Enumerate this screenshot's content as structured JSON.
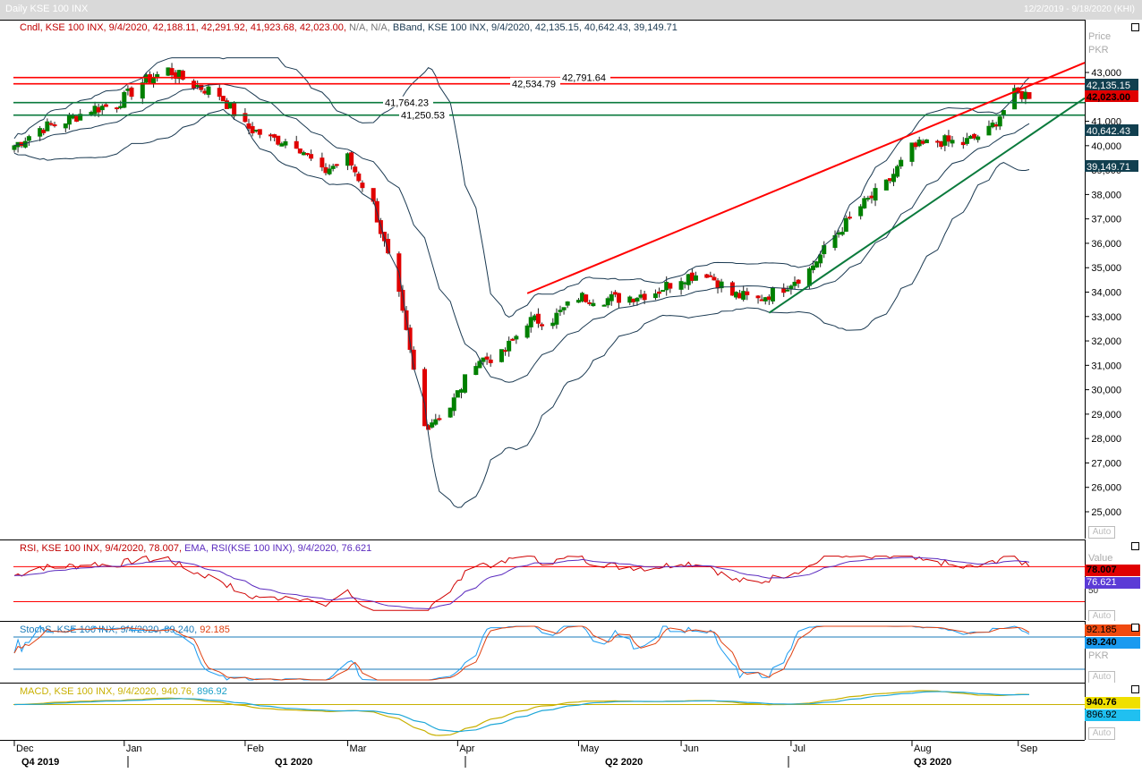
{
  "window": {
    "title": "Daily KSE 100 INX",
    "range": "12/2/2019 - 9/18/2020 (KHI)"
  },
  "price_pane": {
    "legend_cndl": "Cndl, KSE 100 INX, 9/4/2020, 42,188.11, 42,291.92, 41,923.68, 42,023.00,",
    "legend_na": "N/A, N/A,",
    "legend_bband": "BBand, KSE 100 INX, 9/4/2020, 42,135.15, 40,642.43, 39,149.71",
    "scale_title": "Price",
    "scale_unit": "PKR",
    "axis_button": "Auto",
    "ticks": [
      "43,000",
      "42,000",
      "41,000",
      "40,000",
      "39,000",
      "38,000",
      "37,000",
      "36,000",
      "35,000",
      "34,000",
      "33,000",
      "32,000",
      "31,000",
      "30,000",
      "29,000",
      "28,000",
      "27,000",
      "26,000",
      "25,000"
    ],
    "tick_values": [
      43000,
      42000,
      41000,
      40000,
      39000,
      38000,
      37000,
      36000,
      35000,
      34000,
      33000,
      32000,
      31000,
      30000,
      29000,
      28000,
      27000,
      26000,
      25000
    ],
    "value_tags": {
      "bb_upper": "42,135.15",
      "close": "42,023.00",
      "bb_mid": "40,642.43",
      "bb_lower": "39,149.71"
    },
    "levels": {
      "red_top": "42,791.64",
      "red_second": "42,534.79",
      "green_top": "41,764.23",
      "green_second": "41,250.53"
    },
    "colors": {
      "up": "#008000",
      "down": "#e00000",
      "band": "#1b3a52",
      "res": "#ff0000",
      "sup": "#0a7a3c"
    }
  },
  "rsi_pane": {
    "legend_rsi": "RSI, KSE 100 INX, 9/4/2020, 78.007,",
    "legend_ema": "EMA, RSI(KSE 100 INX), 9/4/2020, 76.621",
    "scale_title": "Value",
    "value_tags": {
      "rsi": "78.007",
      "ema": "76.621"
    },
    "tick": "50",
    "axis_button": "Auto"
  },
  "stoch_pane": {
    "legend_a": "StochS, KSE 100 INX, 9/4/2020, 89.240,",
    "legend_b": "92.185",
    "scale_unit": "PKR",
    "value_tags": {
      "d": "92.185",
      "k": "89.240"
    },
    "axis_button": "Auto"
  },
  "macd_pane": {
    "legend_a": "MACD, KSE 100 INX, 9/4/2020, 940.76,",
    "legend_b": "896.92",
    "value_tags": {
      "macd": "940.76",
      "signal": "896.92"
    },
    "axis_button": "Auto"
  },
  "x_axis": {
    "months": [
      "Dec",
      "Jan",
      "Feb",
      "Mar",
      "Apr",
      "May",
      "Jun",
      "Jul",
      "Aug",
      "Sep"
    ],
    "quarters": [
      "Q4 2019",
      "Q1 2020",
      "Q2 2020",
      "Q3 2020"
    ]
  },
  "chart_data": {
    "type": "candlestick",
    "title": "Daily KSE 100 INX",
    "ylabel": "Price PKR",
    "ylim": [
      24500,
      43500
    ],
    "x_range": [
      "12/2/2019",
      "9/18/2020"
    ],
    "month_positions": [
      "2019-12-02",
      "2020-01-01",
      "2020-02-03",
      "2020-03-02",
      "2020-04-01",
      "2020-05-04",
      "2020-06-01",
      "2020-07-01",
      "2020-08-03",
      "2020-09-01"
    ],
    "weekly_close_approx": {
      "dates": [
        "2019-12-02",
        "2019-12-09",
        "2019-12-16",
        "2019-12-23",
        "2019-12-30",
        "2020-01-06",
        "2020-01-13",
        "2020-01-20",
        "2020-01-27",
        "2020-02-03",
        "2020-02-10",
        "2020-02-17",
        "2020-02-24",
        "2020-03-02",
        "2020-03-09",
        "2020-03-16",
        "2020-03-23",
        "2020-03-30",
        "2020-04-06",
        "2020-04-13",
        "2020-04-20",
        "2020-04-27",
        "2020-05-04",
        "2020-05-11",
        "2020-05-18",
        "2020-05-25",
        "2020-06-01",
        "2020-06-08",
        "2020-06-15",
        "2020-06-22",
        "2020-06-29",
        "2020-07-06",
        "2020-07-13",
        "2020-07-20",
        "2020-07-27",
        "2020-08-03",
        "2020-08-10",
        "2020-08-17",
        "2020-08-24",
        "2020-08-31"
      ],
      "values": [
        40000,
        40700,
        41000,
        41500,
        41700,
        42600,
        43100,
        42500,
        42100,
        40800,
        40300,
        40100,
        38900,
        39500,
        37600,
        33800,
        28500,
        29300,
        31200,
        31400,
        32800,
        32900,
        33800,
        33700,
        33800,
        34000,
        34600,
        34800,
        33900,
        33700,
        34200,
        34900,
        36300,
        37500,
        38400,
        39900,
        40200,
        40100,
        40600,
        42100
      ]
    },
    "bollinger_bands": {
      "upper": 42135.15,
      "middle": 40642.43,
      "lower": 39149.71
    },
    "last_candle": {
      "date": "9/4/2020",
      "open": 42188.11,
      "high": 42291.92,
      "low": 41923.68,
      "close": 42023.0
    },
    "horizontal_levels": [
      42791.64,
      42534.79,
      41764.23,
      41250.53
    ],
    "rsi": {
      "value": 78.007,
      "ema": 76.621
    },
    "stochs": {
      "k": 89.24,
      "d": 92.185
    },
    "macd": {
      "macd": 940.76,
      "signal": 896.92
    }
  }
}
